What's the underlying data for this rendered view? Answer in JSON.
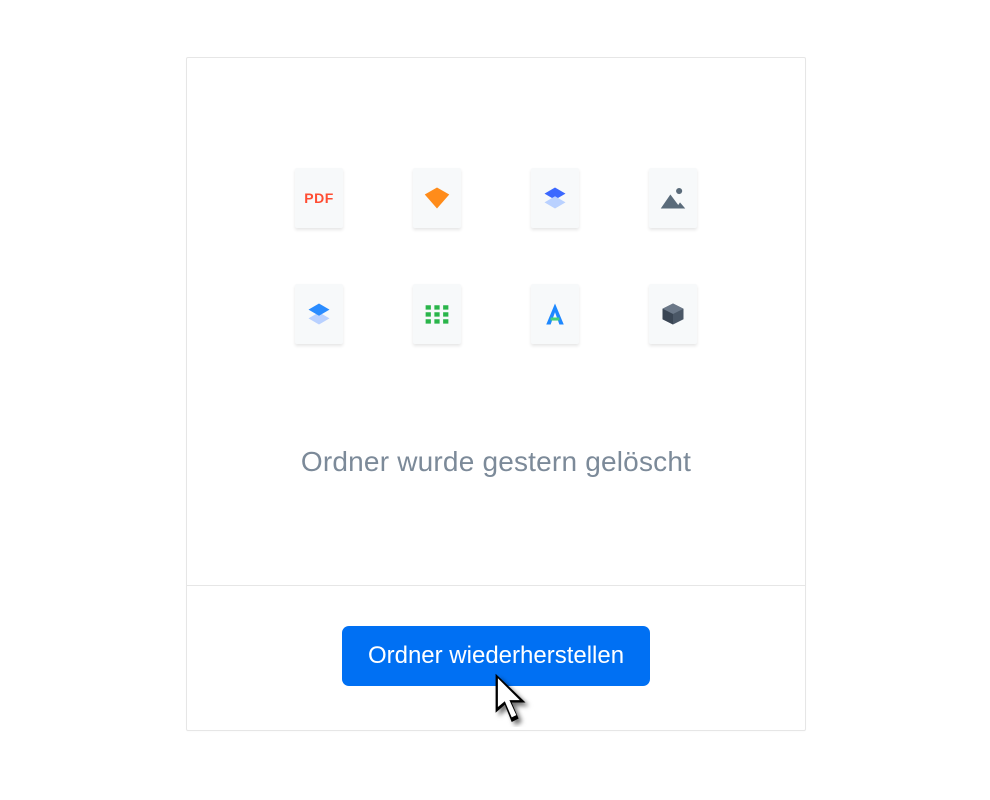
{
  "message": "Ordner wurde gestern gelöscht",
  "restore_label": "Ordner wiederherstellen",
  "files": [
    {
      "name": "pdf-file",
      "icon": "pdf",
      "label": "PDF"
    },
    {
      "name": "sketch-file",
      "icon": "diamond"
    },
    {
      "name": "layers-file",
      "icon": "layers"
    },
    {
      "name": "image-file",
      "icon": "image"
    },
    {
      "name": "layers-file-2",
      "icon": "layers2"
    },
    {
      "name": "grid-file",
      "icon": "grid"
    },
    {
      "name": "a-file",
      "icon": "letter-a"
    },
    {
      "name": "cube-file",
      "icon": "cube"
    }
  ]
}
